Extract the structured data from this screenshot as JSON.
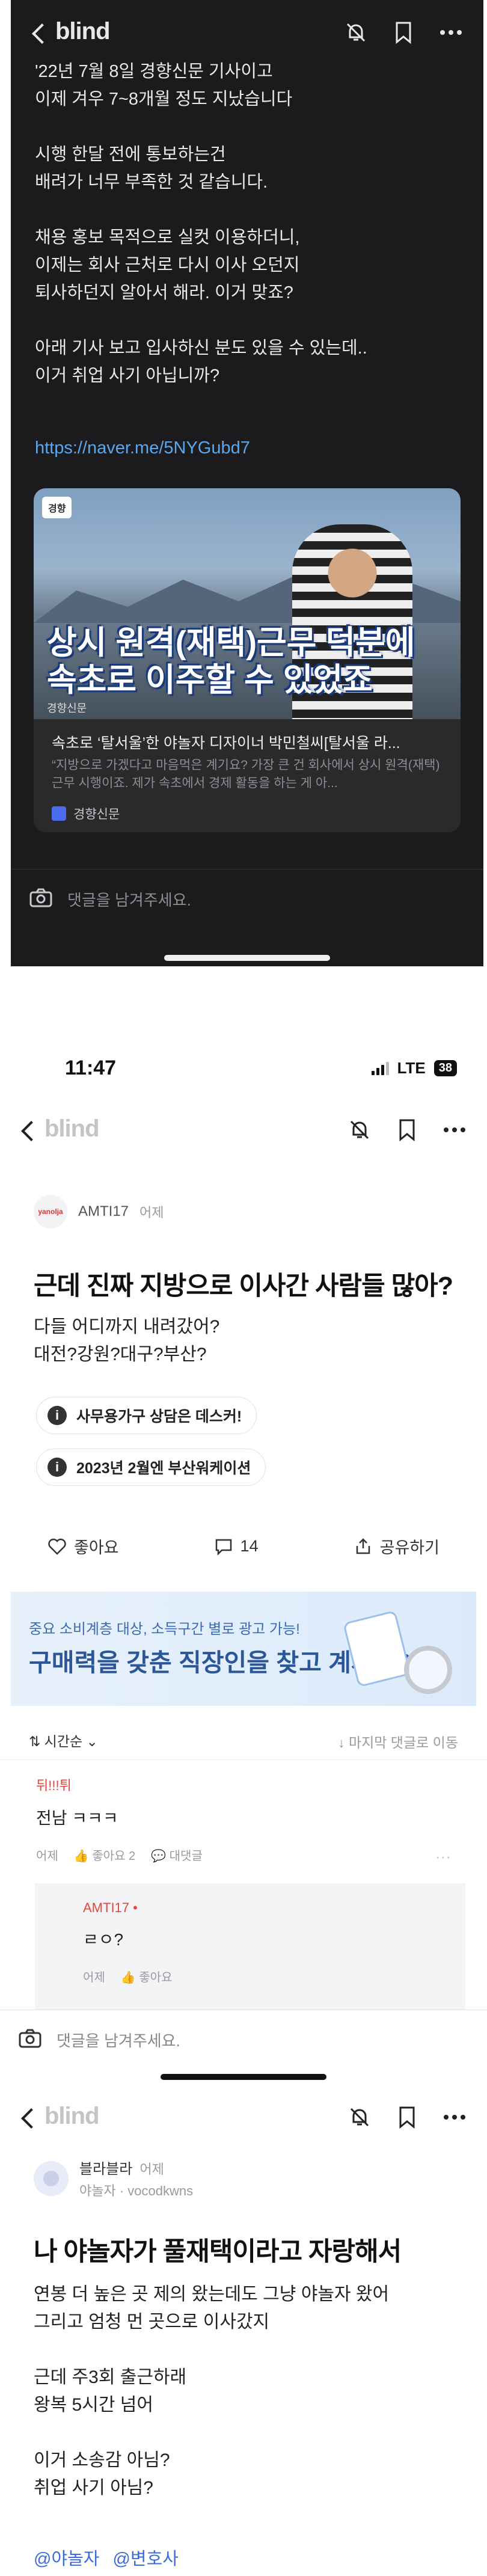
{
  "panel1": {
    "logo": "blind",
    "post_lines": "'22년 7월 8일 경향신문 기사이고\n이제 겨우 7~8개월 정도 지났습니다\n\n시행 한달 전에 통보하는건\n배려가 너무 부족한 것 같습니다.\n\n채용 홍보 목적으로 실컷 이용하더니,\n이제는 회사 근처로 다시 이사 오던지\n퇴사하던지 알아서 해라. 이거 맞죠?\n\n아래 기사 보고 입사하신 분도 있을 수 있는데..\n이거 취업 사기 아닙니까?",
    "link": "https://naver.me/5NYGubd7",
    "card": {
      "image_badge": "경향",
      "image_headline": "상시 원격(재택)근무 덕분에\n속초로 이주할 수 있었죠",
      "image_sub": "경향신문",
      "title": "속초로 ‘탈서울’한 야놀자 디자이너 박민철씨[탈서울 라...",
      "desc": "“지방으로 가겠다고 마음먹은 계기요? 가장 큰 건 회사에서 상시 원격(재택)근무 시행이죠. 제가 속초에서 경제 활동을 하는 게 아...",
      "source": "경향신문"
    },
    "comment_placeholder": "댓글을 남겨주세요."
  },
  "panel2": {
    "status_time": "11:47",
    "status_net": "LTE",
    "status_battery": "38",
    "logo": "blind",
    "author": "AMTI17",
    "author_time": "어제",
    "avatar_text": "yanolja",
    "title": "근데 진짜 지방으로 이사간 사람들 많아?",
    "body": "다들 어디까지 내려갔어?\n대전?강원?대구?부산?",
    "chips": [
      "사무용가구 상담은 데스커!",
      "2023년 2월엔 부산워케이션"
    ],
    "actions": {
      "like": "좋아요",
      "comments": "14",
      "share": "공유하기"
    },
    "ad": {
      "line1": "중요 소비계층 대상, 소득구간 별로 광고 가능!",
      "line2": "구매력을 갖춘 직장인을 찾고 계세요?"
    },
    "sort": {
      "label": "시간순",
      "jump": "마지막 댓글로 이동"
    },
    "comments": [
      {
        "nick": "뒤!!!튀",
        "text": "전남 ㅋㅋㅋ",
        "time": "어제",
        "likes": "좋아요 2",
        "reply": "대댓글"
      },
      {
        "nick": "AMTI17",
        "text": "ㄹㅇ?",
        "time": "어제",
        "likes": "좋아요"
      }
    ],
    "comment_placeholder": "댓글을 남겨주세요."
  },
  "panel3": {
    "logo": "blind",
    "author": "블라블라",
    "author_time": "어제",
    "company": "야놀자 · vocodkwns",
    "title": "나 야놀자가 풀재택이라고 자랑해서",
    "body": "연봉 더 높은 곳 제의 왔는데도 그냥 야놀자 왔어\n그리고 엄청 먼 곳으로 이사갔지\n\n근데 주3회 출근하래\n왕복 5시간 넘어\n\n이거 소송감 아님?\n취업 사기 아님?",
    "tags": [
      "@야놀자",
      "@변호사"
    ]
  },
  "colors": {
    "dark_bg": "#1b1b1d",
    "link": "#5aa7ee",
    "nick_red": "#e3463d",
    "tag_blue": "#3b6bdc"
  }
}
